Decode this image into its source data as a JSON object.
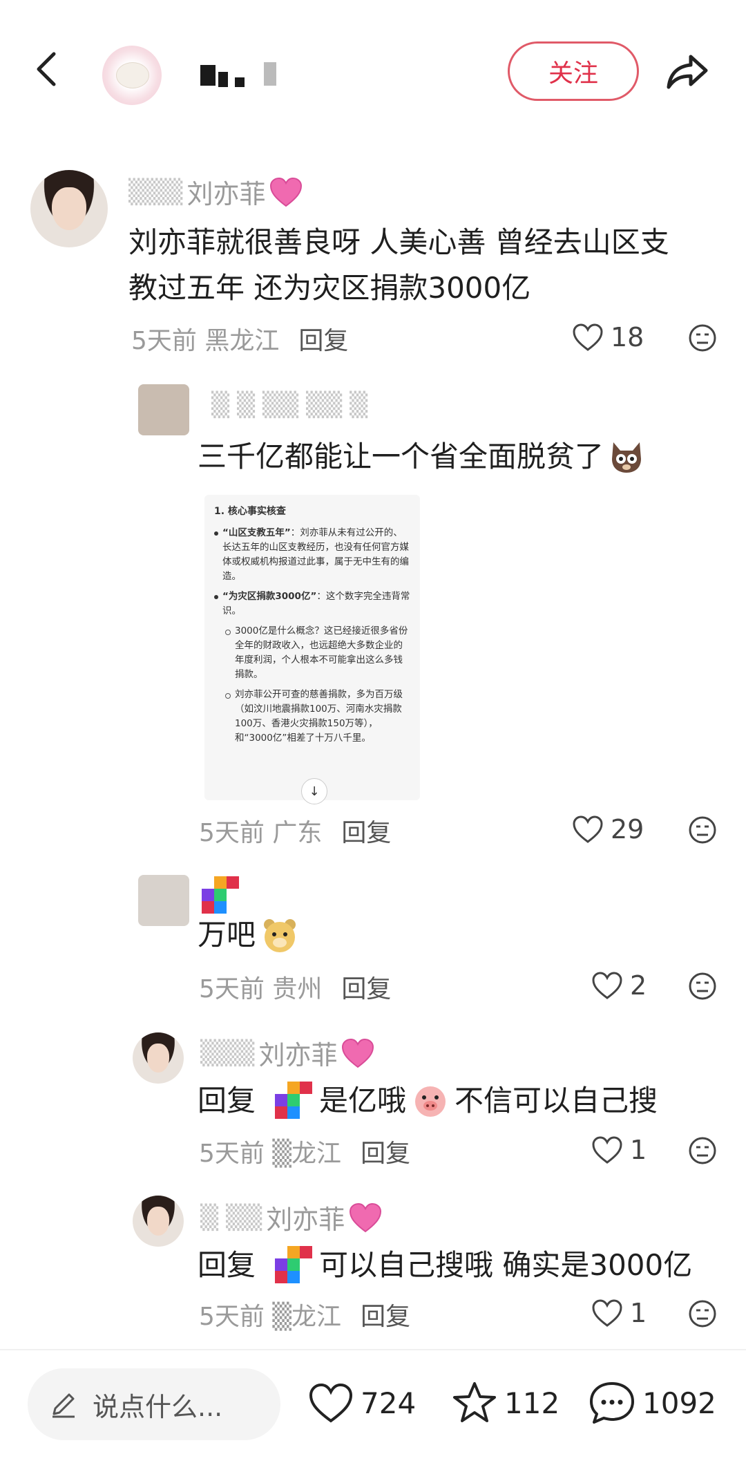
{
  "header": {
    "follow_label": "关注"
  },
  "comments": [
    {
      "name": "刘亦菲",
      "text_line1": "刘亦菲就很善良呀 人美心善 曾经去山区支",
      "text_line2": "教过五年 还为灾区捐款3000亿",
      "time": "5天前",
      "location": "黑龙江",
      "reply_label": "回复",
      "likes": "18"
    },
    {
      "text": "三千亿都能让一个省全面脱贫了",
      "time": "5天前",
      "location": "广东",
      "reply_label": "回复",
      "likes": "29"
    },
    {
      "text": "万吧",
      "time": "5天前",
      "location": "贵州",
      "reply_label": "回复",
      "likes": "2"
    },
    {
      "name": "刘亦菲",
      "reply_prefix": "回复",
      "text_a": "是亿哦",
      "text_b": "不信可以自己搜",
      "time": "5天前",
      "location": "龙江",
      "reply_label": "回复",
      "likes": "1"
    },
    {
      "name": "刘亦菲",
      "reply_prefix": "回复",
      "text": "可以自己搜哦 确实是3000亿",
      "time": "5天前",
      "location": "龙江",
      "reply_label": "回复",
      "likes": "1"
    }
  ],
  "screenshot": {
    "heading": "1. 核心事实核查",
    "bullet1_bold": "“山区支教五年”",
    "bullet1_text": "：刘亦菲从未有过公开的、长达五年的山区支教经历，也没有任何官方媒体或权威机构报道过此事，属于无中生有的编造。",
    "bullet2_bold": "“为灾区捐款3000亿”",
    "bullet2_text": "：这个数字完全违背常识。",
    "sub1": "3000亿是什么概念？这已经接近很多省份全年的财政收入，也远超绝大多数企业的年度利润，个人根本不可能拿出这么多钱捐款。",
    "sub2": "刘亦菲公开可查的慈善捐款，多为百万级（如汶川地震捐款100万、河南水灾捐款100万、香港火灾捐款150万等），和“3000亿”相差了十万八千里。"
  },
  "bottom_bar": {
    "input_placeholder": "说点什么...",
    "likes": "724",
    "favorites": "112",
    "comments": "1092"
  },
  "colors": {
    "accent": "#e0314a",
    "meta": "#9a9a9a"
  }
}
